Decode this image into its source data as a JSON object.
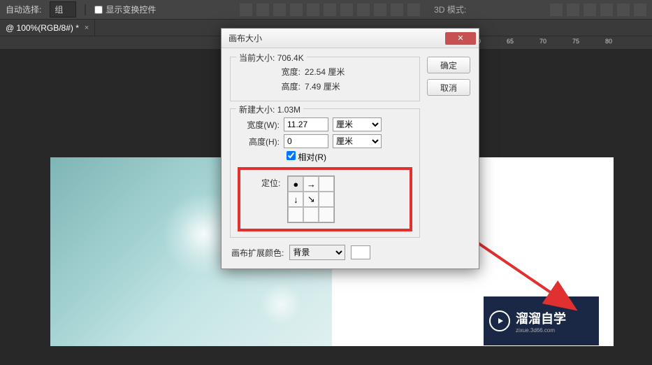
{
  "toolbar": {
    "auto_select_label": "自动选择:",
    "group_option": "组",
    "show_transform_label": "显示变换控件",
    "mode_label": "3D 模式:"
  },
  "tab": {
    "title": "@ 100%(RGB/8#) *"
  },
  "ruler": {
    "ticks": [
      "60",
      "65",
      "70",
      "75",
      "80"
    ]
  },
  "dialog": {
    "title": "画布大小",
    "btn_ok": "确定",
    "btn_cancel": "取消",
    "current": {
      "legend": "当前大小:",
      "size": "706.4K",
      "width_label": "宽度:",
      "width_val": "22.54 厘米",
      "height_label": "高度:",
      "height_val": "7.49 厘米"
    },
    "new": {
      "legend": "新建大小:",
      "size": "1.03M",
      "width_label": "宽度(W):",
      "width_val": "11.27",
      "width_unit": "厘米",
      "height_label": "高度(H):",
      "height_val": "0",
      "height_unit": "厘米",
      "relative_label": "相对(R)",
      "anchor_label": "定位:"
    },
    "extension": {
      "label": "画布扩展颜色:",
      "value": "背景"
    }
  },
  "watermark": {
    "text": "溜溜自学",
    "sub": "zixue.3d66.com"
  }
}
